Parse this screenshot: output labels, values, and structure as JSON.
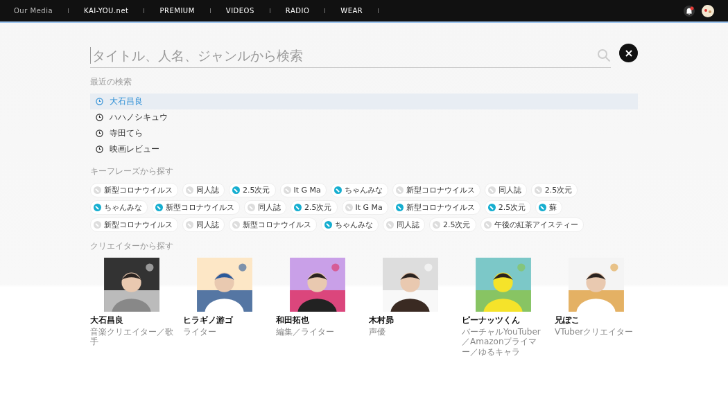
{
  "top_nav": {
    "items": [
      "Our Media",
      "KAI-YOU.net",
      "PREMIUM",
      "VIDEOS",
      "RADIO",
      "WEAR"
    ],
    "notification": true
  },
  "search": {
    "placeholder": "タイトル、人名、ジャンルから検索"
  },
  "recent": {
    "title": "最近の検索",
    "items": [
      {
        "label": "大石昌良",
        "selected": true
      },
      {
        "label": "ハハノシキュウ",
        "selected": false
      },
      {
        "label": "寺田てら",
        "selected": false
      },
      {
        "label": "映画レビュー",
        "selected": false
      }
    ]
  },
  "keyphrases": {
    "title": "キーフレーズから探す",
    "items": [
      {
        "label": "新型コロナウイルス",
        "highlighted": false
      },
      {
        "label": "同人誌",
        "highlighted": false
      },
      {
        "label": "2.5次元",
        "highlighted": true
      },
      {
        "label": "It G Ma",
        "highlighted": false
      },
      {
        "label": "ちゃんみな",
        "highlighted": true
      },
      {
        "label": "新型コロナウイルス",
        "highlighted": false
      },
      {
        "label": "同人誌",
        "highlighted": false
      },
      {
        "label": "2.5次元",
        "highlighted": false
      },
      {
        "label": "ちゃんみな",
        "highlighted": true
      },
      {
        "label": "新型コロナウイルス",
        "highlighted": true
      },
      {
        "label": "同人誌",
        "highlighted": false
      },
      {
        "label": "2.5次元",
        "highlighted": true
      },
      {
        "label": "It G Ma",
        "highlighted": false
      },
      {
        "label": "新型コロナウイルス",
        "highlighted": true
      },
      {
        "label": "2.5次元",
        "highlighted": true
      },
      {
        "label": "蘇",
        "highlighted": true
      },
      {
        "label": "新型コロナウイルス",
        "highlighted": false
      },
      {
        "label": "同人誌",
        "highlighted": false
      },
      {
        "label": "新型コロナウイルス",
        "highlighted": false
      },
      {
        "label": "ちゃんみな",
        "highlighted": true
      },
      {
        "label": "同人誌",
        "highlighted": false
      },
      {
        "label": "2.5次元",
        "highlighted": false
      },
      {
        "label": "午後の紅茶アイスティー",
        "highlighted": false
      }
    ]
  },
  "creators": {
    "title": "クリエイターから探す",
    "items": [
      {
        "name": "大石昌良",
        "role": "音楽クリエイター／歌手",
        "kind": "picture"
      },
      {
        "name": "ヒラギノ游ゴ",
        "role": "ライター",
        "kind": "picture"
      },
      {
        "name": "和田拓也",
        "role": "編集／ライター",
        "kind": "picture"
      },
      {
        "name": "木村昴",
        "role": "声優",
        "kind": "picture"
      },
      {
        "name": "ピーナッツくん",
        "role": "バーチャルYouTuber／Amazonプライマー／ゆるキャラ",
        "kind": "picture"
      },
      {
        "name": "兄ぽこ",
        "role": "VTuberクリエイター",
        "kind": "picture"
      }
    ]
  }
}
